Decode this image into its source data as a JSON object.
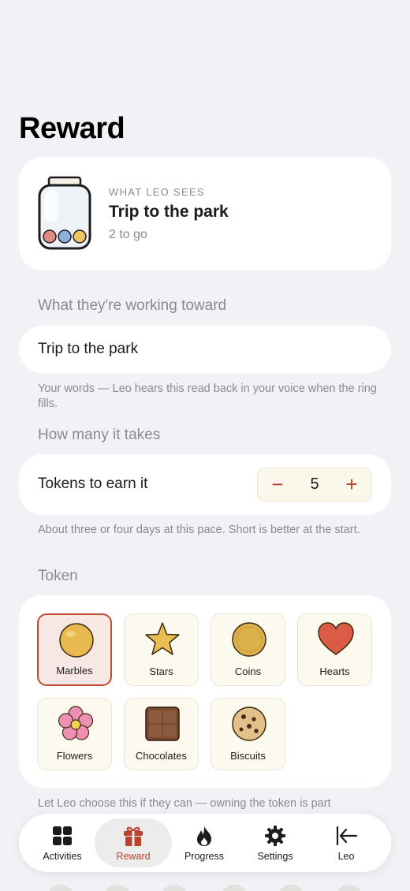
{
  "page": {
    "title": "Reward"
  },
  "preview": {
    "eyebrow": "WHAT LEO SEES",
    "title": "Trip to the park",
    "subtitle": "2 to go"
  },
  "goal": {
    "section_label": "What they're working toward",
    "value": "Trip to the park",
    "helper": "Your words — Leo hears this read back in your voice when the ring fills."
  },
  "count": {
    "section_label": "How many it takes",
    "label": "Tokens to earn it",
    "minus": "−",
    "value": "5",
    "plus": "+",
    "helper": "About three or four days at this pace. Short is better at the start."
  },
  "token": {
    "section_label": "Token",
    "selected": "Marbles",
    "options": [
      {
        "name": "Marbles",
        "icon": "marble-icon"
      },
      {
        "name": "Stars",
        "icon": "star-icon"
      },
      {
        "name": "Coins",
        "icon": "coin-icon"
      },
      {
        "name": "Hearts",
        "icon": "heart-icon"
      },
      {
        "name": "Flowers",
        "icon": "flower-icon"
      },
      {
        "name": "Chocolates",
        "icon": "chocolate-icon"
      },
      {
        "name": "Biscuits",
        "icon": "biscuit-icon"
      }
    ],
    "helper": "Let Leo choose this if they can — owning the token is part"
  },
  "tabbar": {
    "active": "Reward",
    "tabs": [
      {
        "label": "Activities",
        "icon": "grid-icon"
      },
      {
        "label": "Reward",
        "icon": "gift-icon"
      },
      {
        "label": "Progress",
        "icon": "flame-icon"
      },
      {
        "label": "Settings",
        "icon": "gear-icon"
      },
      {
        "label": "Leo",
        "icon": "exit-arrow-icon"
      }
    ]
  },
  "colors": {
    "accent": "#b8432e",
    "background": "#f2f2f6",
    "card": "#ffffff",
    "muted_text": "#8a8a8e"
  }
}
